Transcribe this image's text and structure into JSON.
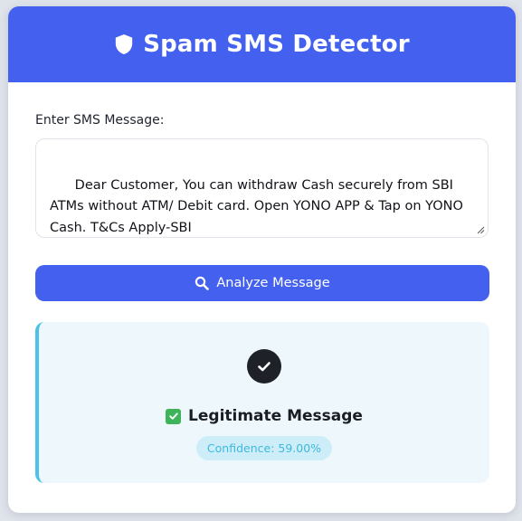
{
  "header": {
    "title": "Spam SMS Detector",
    "icon": "shield-icon",
    "color": "#4361ee"
  },
  "form": {
    "label": "Enter SMS Message:",
    "message": "Dear Customer, You can withdraw Cash securely from SBI ATMs without ATM/ Debit card. Open YONO APP & Tap on YONO Cash. T&Cs Apply-SBI",
    "analyze_label": "Analyze Message",
    "analyze_icon": "search-icon"
  },
  "result": {
    "status_icon": "check-circle-icon",
    "verdict": "Legitimate Message",
    "verdict_icon": "green-checkbox-icon",
    "confidence": "Confidence: 59.00%",
    "accent_color": "#4cc3e6"
  }
}
